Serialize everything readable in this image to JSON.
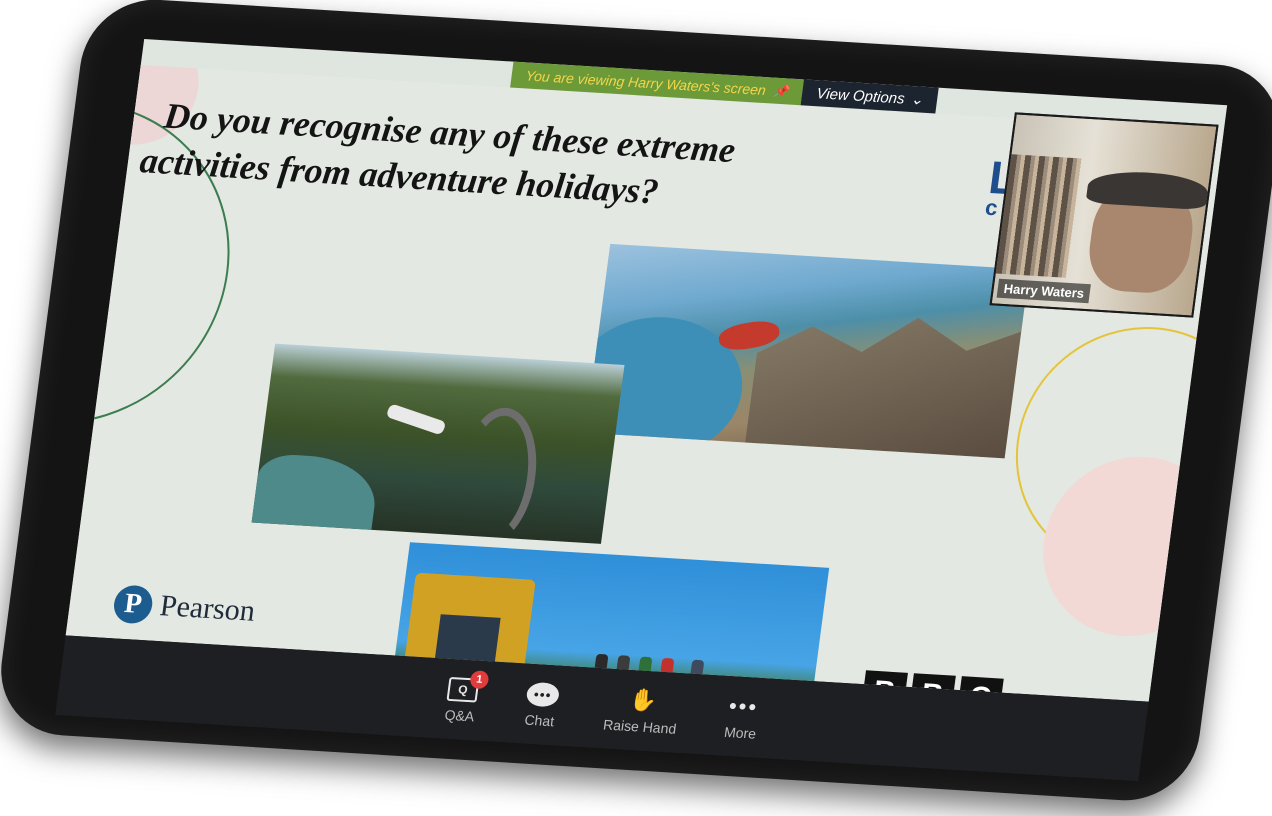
{
  "share_banner": {
    "viewing_text": "You are viewing Harry Waters's screen",
    "view_options_label": "View Options",
    "chevron_icon": "chevron-down-icon",
    "pin_icon": "pin-icon"
  },
  "slide": {
    "title_line1": "Do you recognise any of these extreme",
    "title_line2": "activities from adventure holidays?",
    "logo_partial_big": "L",
    "logo_partial_small": "c",
    "photos": [
      "skydiving",
      "bungee-jumping",
      "digger-experience"
    ],
    "pearson_logo_letter": "P",
    "pearson_logo_word": "Pearson",
    "bbc_letters": [
      "B",
      "B",
      "C"
    ]
  },
  "video_tile": {
    "participant_name": "Harry Waters"
  },
  "toolbar": {
    "qa_label": "Q&A",
    "qa_icon_text": "Q",
    "qa_badge": "1",
    "chat_label": "Chat",
    "chat_icon_text": "•••",
    "raise_hand_label": "Raise Hand",
    "raise_hand_icon": "✋",
    "more_label": "More",
    "more_icon_text": "•••"
  },
  "colors": {
    "banner_green": "#6d9a38",
    "banner_text": "#f2d64a",
    "toolbar_bg": "#1d1f22",
    "badge_red": "#e23b3b",
    "pearson_blue": "#1d5c8f"
  }
}
